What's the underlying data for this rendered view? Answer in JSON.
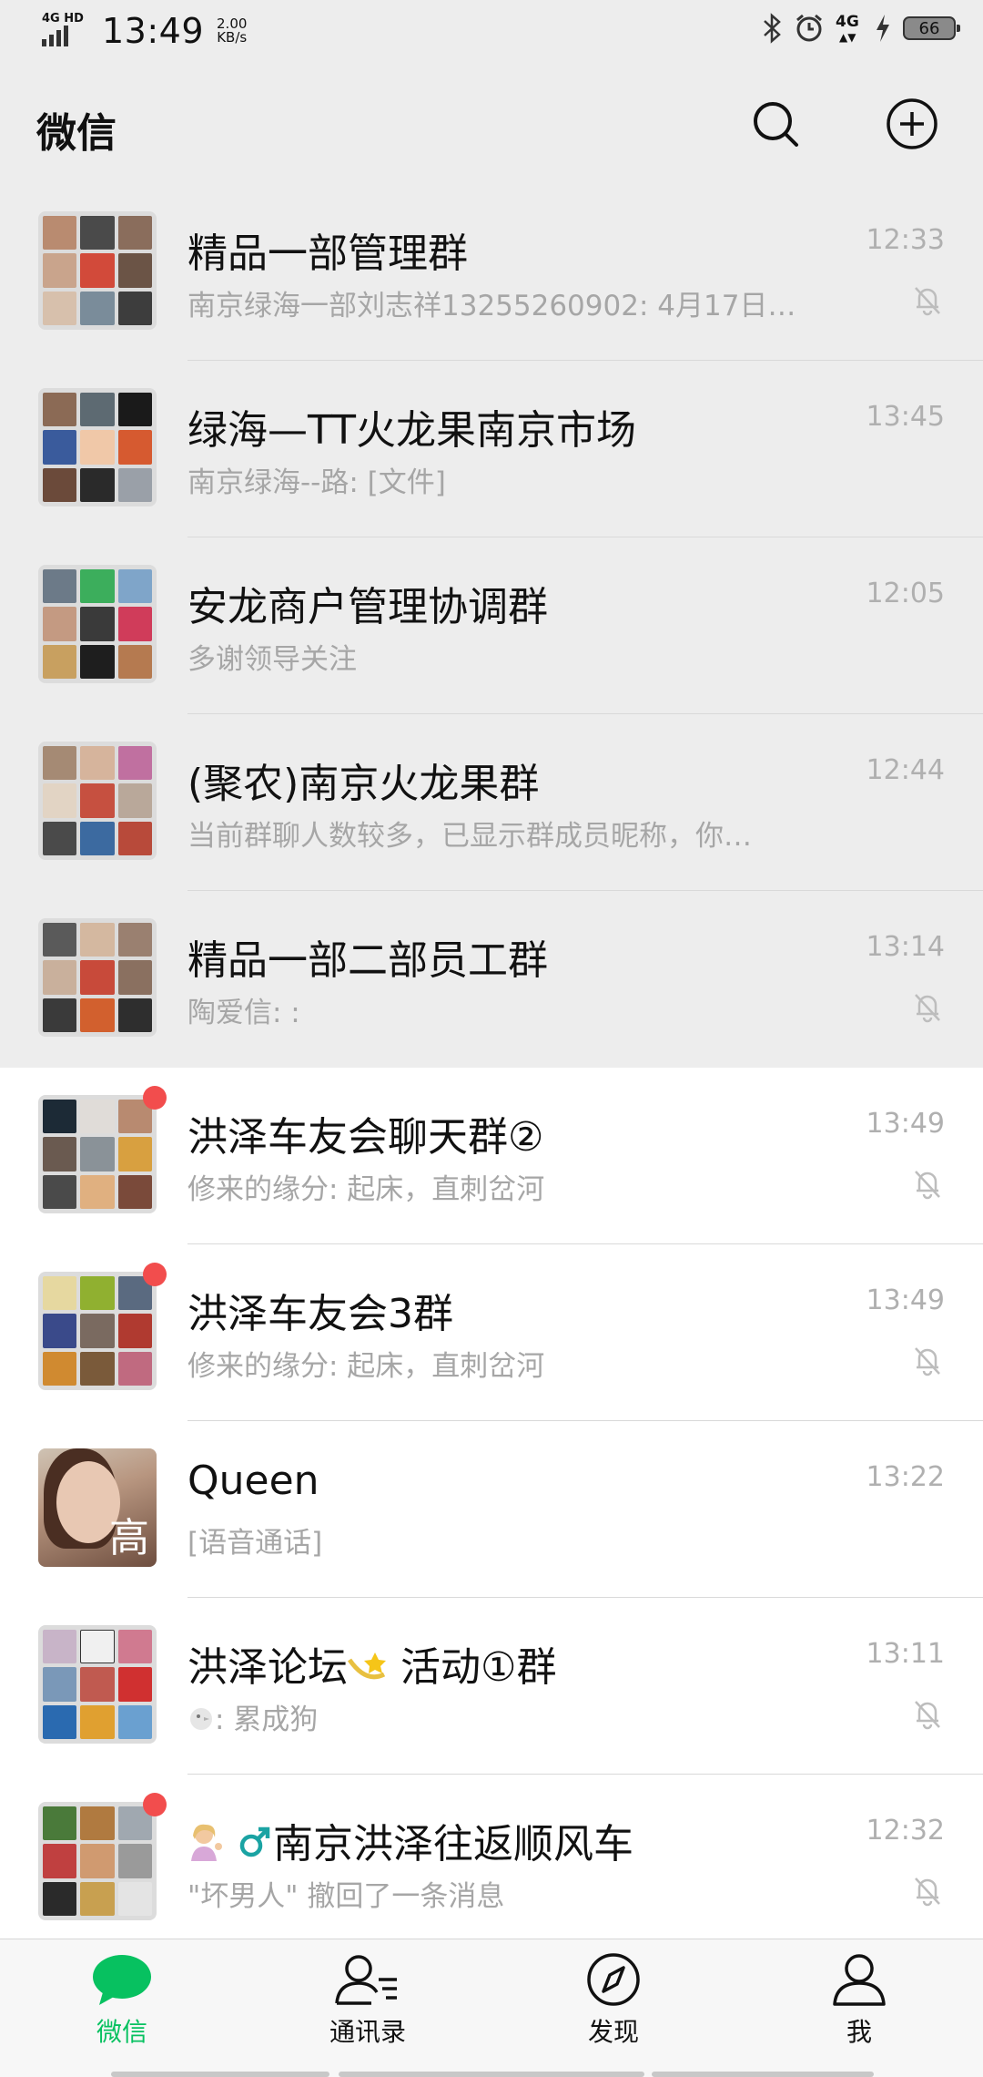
{
  "status_bar": {
    "network": "4G HD",
    "time": "13:49",
    "speed_value": "2.00",
    "speed_unit": "KB/s",
    "signal_right": "4G",
    "battery": "66"
  },
  "header": {
    "title": "微信",
    "search_icon": "search-icon",
    "add_icon": "plus-circle-icon"
  },
  "chats": [
    {
      "name": "精品一部管理群",
      "preview": "南京绿海一部刘志祥13255260902: 4月17日…",
      "time": "12:33",
      "muted": true,
      "unread": false,
      "pinned": true
    },
    {
      "name": "绿海—TT火龙果南京市场",
      "preview": "南京绿海--路: [文件]",
      "time": "13:45",
      "muted": false,
      "unread": false,
      "pinned": true
    },
    {
      "name": "安龙商户管理协调群",
      "preview": "多谢领导关注",
      "time": "12:05",
      "muted": false,
      "unread": false,
      "pinned": true
    },
    {
      "name": "(聚农)南京火龙果群",
      "preview": "当前群聊人数较多，已显示群成员昵称，你…",
      "time": "12:44",
      "muted": false,
      "unread": false,
      "pinned": true
    },
    {
      "name": "精品一部二部员工群",
      "preview": "陶爱信: :",
      "time": "13:14",
      "muted": true,
      "unread": false,
      "pinned": true
    },
    {
      "name": "洪泽车友会聊天群②",
      "preview": "修来的缘分: 起床，直刺岔河",
      "time": "13:49",
      "muted": true,
      "unread": true,
      "pinned": false
    },
    {
      "name": "洪泽车友会3群",
      "preview": "修来的缘分: 起床，直刺岔河",
      "time": "13:49",
      "muted": true,
      "unread": true,
      "pinned": false
    },
    {
      "name": "Queen",
      "preview": "[语音通话]",
      "time": "13:22",
      "muted": false,
      "unread": false,
      "pinned": false
    },
    {
      "name": "洪泽论坛",
      "name_suffix": "活动①群",
      "preview": ": 累成狗",
      "time": "13:11",
      "muted": true,
      "unread": false,
      "pinned": false
    },
    {
      "name": "南京洪泽往返顺风车",
      "preview": "\"坏男人\" 撤回了一条消息",
      "time": "12:32",
      "muted": true,
      "unread": true,
      "pinned": false
    }
  ],
  "queen_avatar_glyph": "高",
  "tabs": [
    {
      "label": "微信",
      "icon": "chat-bubble-icon",
      "active": true
    },
    {
      "label": "通讯录",
      "icon": "contacts-icon",
      "active": false
    },
    {
      "label": "发现",
      "icon": "compass-icon",
      "active": false
    },
    {
      "label": "我",
      "icon": "person-icon",
      "active": false
    }
  ],
  "colors": {
    "accent": "#07c160",
    "unread": "#f24d4d",
    "background": "#ededed"
  }
}
